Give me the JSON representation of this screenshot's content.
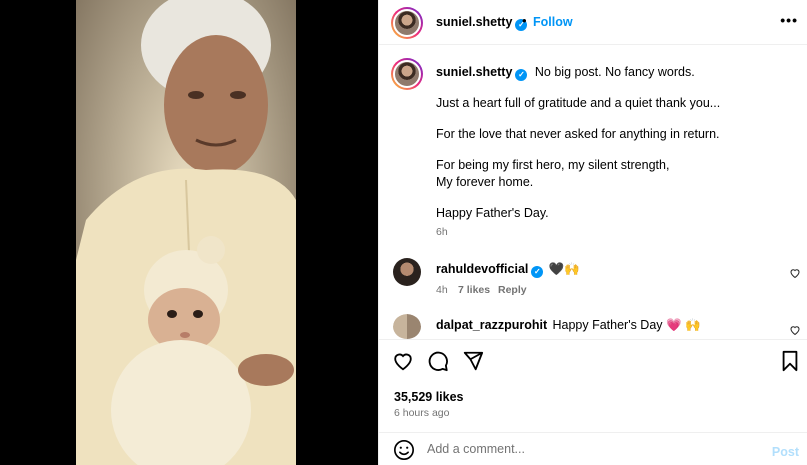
{
  "post": {
    "author": "suniel.shetty",
    "follow_label": "Follow",
    "more_label": "•••",
    "dot": "•",
    "verified_glyph": "✓"
  },
  "caption": {
    "user": "suniel.shetty",
    "first_line": "No big post. No fancy words.",
    "lines": [
      "Just a heart full of gratitude and a quiet thank you...",
      "For the love that never asked for anything in return.",
      "For being my first hero, my silent strength,",
      "My forever home.",
      "Happy Father's Day."
    ],
    "time": "6h"
  },
  "comments": [
    {
      "user": "rahuldevofficial",
      "text": "🖤🙌",
      "time": "4h",
      "likes": "7 likes",
      "reply": "Reply"
    },
    {
      "user": "dalpat_razzpurohit",
      "text": "Happy Father's Day 💗 🙌"
    }
  ],
  "actions": {
    "likes": "35,529 likes",
    "ago": "6 hours ago",
    "comment_placeholder": "Add a comment...",
    "post_label": "Post"
  },
  "icons": {
    "like": "heart-icon",
    "comment": "comment-icon",
    "share": "share-icon",
    "save": "bookmark-icon",
    "emoji": "emoji-icon",
    "comment_like": "heart-outline-icon"
  },
  "colors": {
    "link_blue": "#0095f6",
    "muted": "#737373",
    "post_disabled": "#b2dffc"
  }
}
